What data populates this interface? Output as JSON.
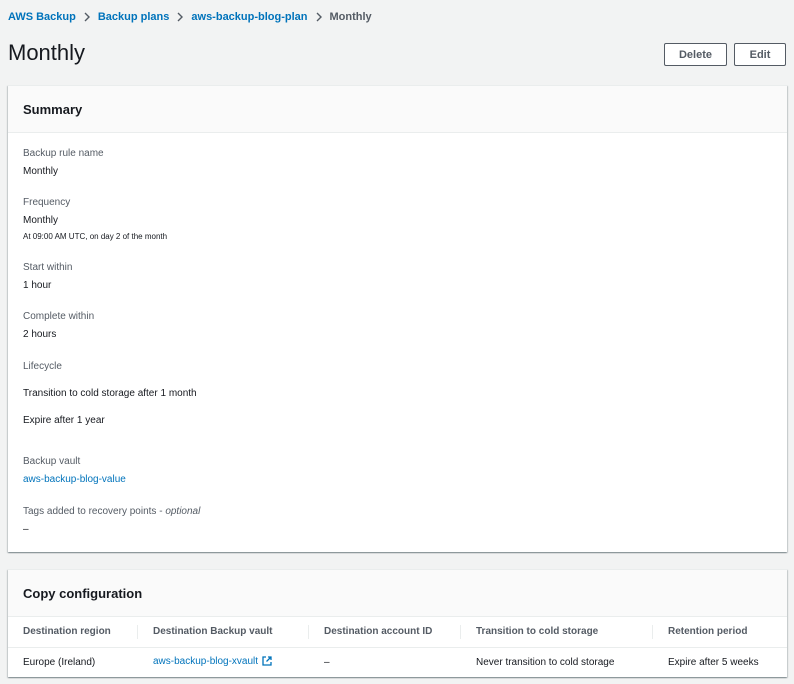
{
  "breadcrumb": {
    "items": [
      "AWS Backup",
      "Backup plans",
      "aws-backup-blog-plan"
    ],
    "current": "Monthly"
  },
  "page": {
    "title": "Monthly",
    "delete_label": "Delete",
    "edit_label": "Edit"
  },
  "summary": {
    "header": "Summary",
    "rule_name_label": "Backup rule name",
    "rule_name_value": "Monthly",
    "frequency_label": "Frequency",
    "frequency_value": "Monthly",
    "frequency_detail": "At 09:00 AM UTC, on day 2 of the month",
    "start_within_label": "Start within",
    "start_within_value": "1 hour",
    "complete_within_label": "Complete within",
    "complete_within_value": "2 hours",
    "lifecycle_label": "Lifecycle",
    "lifecycle_transition": "Transition to cold storage after 1 month",
    "lifecycle_expire": "Expire after 1 year",
    "vault_label": "Backup vault",
    "vault_value": "aws-backup-blog-value",
    "tags_label": "Tags added to recovery points - ",
    "tags_optional": "optional",
    "tags_value": "–"
  },
  "copy": {
    "header": "Copy configuration",
    "columns": [
      "Destination region",
      "Destination Backup vault",
      "Destination account ID",
      "Transition to cold storage",
      "Retention period"
    ],
    "rows": [
      {
        "region": "Europe (Ireland)",
        "vault": "aws-backup-blog-xvault",
        "account": "–",
        "transition": "Never transition to cold storage",
        "retention": "Expire after 5 weeks"
      }
    ]
  },
  "colors": {
    "link": "#0073bb",
    "background": "#f2f3f3",
    "text": "#16191f",
    "muted": "#545b64"
  }
}
